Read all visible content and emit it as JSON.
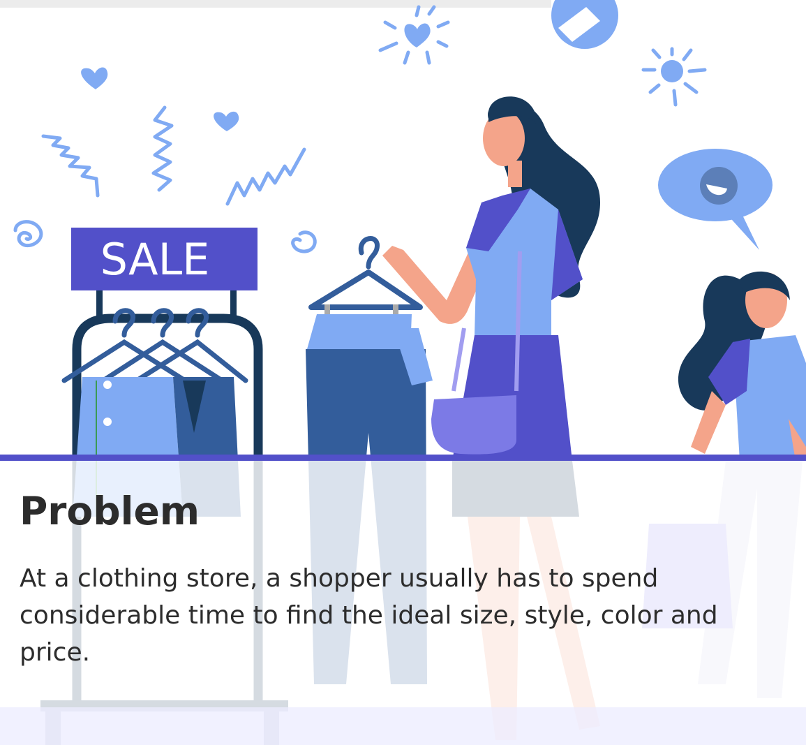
{
  "card": {
    "illustration": {
      "sign_text": "SALE",
      "colors": {
        "indigo": "#5250c9",
        "navy": "#18395a",
        "light_blue": "#80aaf3",
        "mid_blue": "#335d9b",
        "lavender": "#7c7ae6",
        "skin": "#f4a48a"
      }
    },
    "title": "Problem",
    "description": "At a clothing store, a shopper usually has to spend considerable time to find the ideal size, style, color and price."
  }
}
